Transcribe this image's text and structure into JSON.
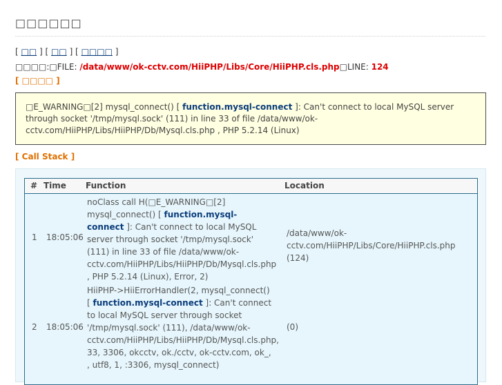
{
  "page": {
    "title": "□□□□□□"
  },
  "nav": {
    "sep_open": "[",
    "sep_mid": "] [",
    "sep_close": "]",
    "item1": "□□",
    "item2": "□□",
    "item3": "□□□□"
  },
  "error_position": {
    "label": "□□□□:□FILE: ",
    "file": "/data/www/ok-cctv.com/HiiPHP/Libs/Core/HiiPHP.cls.php",
    "line_label": "□LINE: ",
    "line": "124"
  },
  "trace_link": "[ □□□□ ]",
  "error_box": {
    "part1": "□E_WARNING□[2] mysql_connect() [ ",
    "link": "function.mysql-connect",
    "part2": " ]: Can't connect to local MySQL server through socket '/tmp/mysql.sock' (111) in line 33 of file /data/www/ok-cctv.com/HiiPHP/Libs/HiiPHP/Db/Mysql.cls.php , PHP 5.2.14 (Linux)"
  },
  "call_stack": {
    "title": "[ Call Stack ]",
    "headers": {
      "num": "#",
      "time": "Time",
      "function": "Function",
      "location": "Location"
    },
    "rows": [
      {
        "num": "1",
        "time": "18:05:06",
        "fn_part1": "noClass call H(□E_WARNING□[2] mysql_connect() [ ",
        "fn_link": "function.mysql-connect",
        "fn_part2": " ]: Can't connect to local MySQL server through socket '/tmp/mysql.sock' (111) in line 33 of file /data/www/ok-cctv.com/HiiPHP/Libs/HiiPHP/Db/Mysql.cls.php , PHP 5.2.14 (Linux), Error, 2)",
        "location": "/data/www/ok-cctv.com/HiiPHP/Libs/Core/HiiPHP.cls.php (124)"
      },
      {
        "num": "2",
        "time": "18:05:06",
        "fn_part1": "HiiPHP->HiiErrorHandler(2, mysql_connect() [ ",
        "fn_link": "function.mysql-connect",
        "fn_part2": " ]: Can't connect to local MySQL server through socket '/tmp/mysql.sock' (111), /data/www/ok-cctv.com/HiiPHP/Libs/HiiPHP/Db/Mysql.cls.php, 33, 3306, okcctv, ok./cctv, ok-cctv.com, ok_, , utf8, 1, :3306, mysql_connect)",
        "location": "(0)"
      }
    ]
  }
}
